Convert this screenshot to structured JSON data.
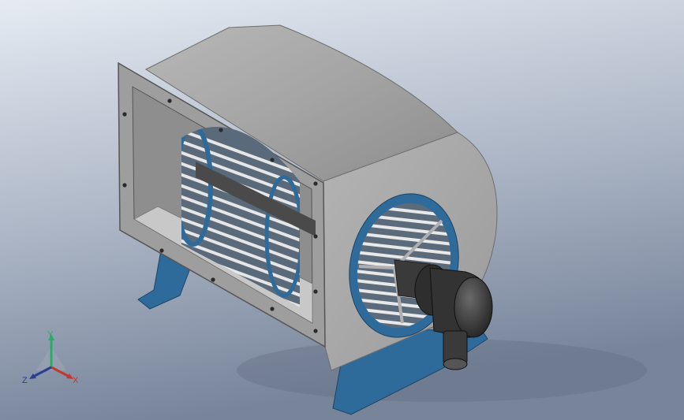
{
  "triad": {
    "y_label": "Y",
    "x_label": "X",
    "z_label": "Z"
  },
  "colors": {
    "background_top": "#dfe5ef",
    "background_bottom": "#7e8ba0",
    "housing": "#a9a9a9",
    "housing_light": "#c4c4c4",
    "housing_dark": "#8a8a8a",
    "accent_blue": "#2f6b9a",
    "wheel_blade": "#e6e6e6",
    "motor": "#3a3a3a",
    "axis_x": "#c0392b",
    "axis_y": "#27ae60",
    "axis_z": "#2c3e91"
  },
  "icons": {
    "model": "centrifugal-blower-icon",
    "triad": "coordinate-triad-icon"
  }
}
